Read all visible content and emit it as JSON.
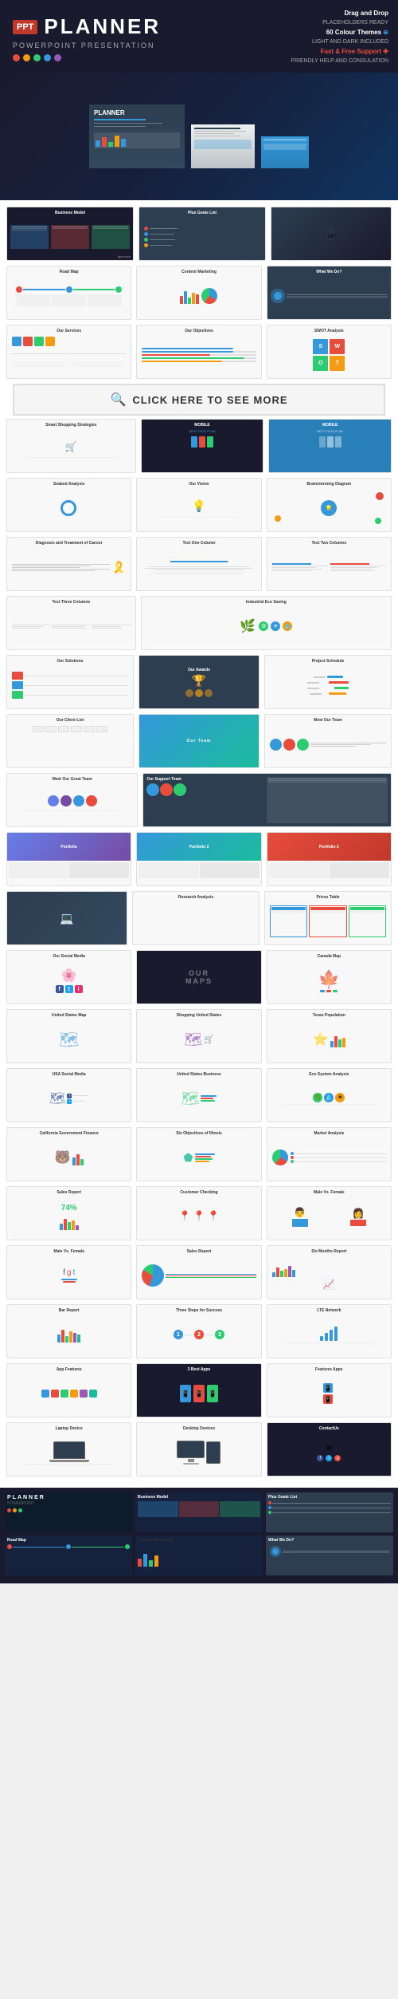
{
  "header": {
    "ppt_label": "PPT",
    "title": "PLANNER",
    "subtitle": "POWERPOINT PRESENTATION",
    "dots": [
      "#e74c3c",
      "#f39c12",
      "#2ecc71",
      "#3498db",
      "#9b59b6"
    ]
  },
  "hero": {
    "features": [
      "Drag and Drop",
      "PLACEHOLDERS READY",
      "60 Colour Themes",
      "LIGHT AND DARK INCLUDED",
      "Fast & Free Support",
      "FRIENDLY HELP AND CONSULATION"
    ]
  },
  "cta": {
    "text": "CLICK HERE TO SEE MORE",
    "icon": "🔍"
  },
  "slides": {
    "row1": [
      {
        "title": "Business Model",
        "type": "dark_logo"
      },
      {
        "title": "Plus Goals List",
        "type": "list_dark"
      },
      {
        "title": "",
        "type": "photo_dark"
      }
    ],
    "row2": [
      {
        "title": "Road Map",
        "type": "roadmap"
      },
      {
        "title": "Content Marketing",
        "type": "charts"
      },
      {
        "title": "What We Do?",
        "type": "what_we_do"
      }
    ],
    "row3": [
      {
        "title": "Our Services",
        "type": "services"
      },
      {
        "title": "Our Objectives",
        "type": "objectives"
      },
      {
        "title": "SWOT Analysis",
        "type": "swot"
      }
    ],
    "row4": [
      {
        "title": "Smart Shopping Strategies",
        "type": "shopping"
      },
      {
        "title": "Mobile Best Data Plan",
        "type": "mobile_dark"
      },
      {
        "title": "Mobile Best Data Plan",
        "type": "mobile_blue"
      }
    ],
    "row5": [
      {
        "title": "Seabed Analysis",
        "type": "analysis"
      },
      {
        "title": "Our Vision",
        "type": "vision"
      },
      {
        "title": "Brainstorming Diagram",
        "type": "brainstorm"
      }
    ],
    "row6": [
      {
        "title": "Diagnosis and Treatment of Cancer",
        "type": "cancer"
      },
      {
        "title": "Text One Column",
        "type": "text1col"
      },
      {
        "title": "Test Two Columns",
        "type": "text2col"
      }
    ],
    "row7": [
      {
        "title": "Test Three Columns",
        "type": "text3col"
      },
      {
        "title": "Industrial Eco Saving",
        "type": "eco"
      }
    ],
    "row8": [
      {
        "title": "Our Solutions",
        "type": "solutions"
      },
      {
        "title": "Our Awards",
        "type": "awards"
      },
      {
        "title": "Project Schedule",
        "type": "schedule"
      }
    ],
    "row9": [
      {
        "title": "Our Client List",
        "type": "clients"
      },
      {
        "title": "",
        "type": "photo_team"
      },
      {
        "title": "Meet Our Team",
        "type": "meet_team"
      }
    ],
    "row10": [
      {
        "title": "Meet Our Great Team",
        "type": "great_team"
      },
      {
        "title": "Our Support Team",
        "type": "support_team"
      }
    ],
    "row11": [
      {
        "title": "Portfolio",
        "type": "portfolio1"
      },
      {
        "title": "Portfolio 2",
        "type": "portfolio2"
      },
      {
        "title": "Portfolio 3",
        "type": "portfolio3"
      }
    ],
    "row12": [
      {
        "title": "",
        "type": "photo_laptop"
      },
      {
        "title": "Research Analysis",
        "type": "research"
      },
      {
        "title": "Prices Table",
        "type": "prices"
      }
    ],
    "row13": [
      {
        "title": "Our Social Media",
        "type": "social_media"
      },
      {
        "title": "OUR MAPS",
        "type": "our_maps"
      },
      {
        "title": "Canada Map",
        "type": "canada_map"
      }
    ],
    "row14": [
      {
        "title": "United States Map",
        "type": "us_map"
      },
      {
        "title": "Shopping United States",
        "type": "shopping_us"
      },
      {
        "title": "Texas Population",
        "type": "texas"
      }
    ],
    "row15": [
      {
        "title": "USA Social Media",
        "type": "usa_social"
      },
      {
        "title": "United States Business",
        "type": "us_business"
      },
      {
        "title": "Eco System Analysis",
        "type": "eco_system"
      }
    ],
    "row16": [
      {
        "title": "California Government Finance",
        "type": "california"
      },
      {
        "title": "Six Objectives of Illinois",
        "type": "illinois"
      },
      {
        "title": "Market Analysis",
        "type": "market_analysis"
      }
    ],
    "row17": [
      {
        "title": "Sales Report",
        "type": "sales_report"
      },
      {
        "title": "Customer Checking",
        "type": "customer_checking"
      },
      {
        "title": "Male Vs. Female",
        "type": "male_female"
      }
    ],
    "row18": [
      {
        "title": "Male Vs. Female",
        "type": "male_female2"
      },
      {
        "title": "Sales Report",
        "type": "sales_report2"
      },
      {
        "title": "Six Months Report",
        "type": "six_months"
      }
    ],
    "row19": [
      {
        "title": "Bar Report",
        "type": "bar_report"
      },
      {
        "title": "Three Steps for Success",
        "type": "three_steps"
      },
      {
        "title": "LTE Network",
        "type": "lte_network"
      }
    ],
    "row20": [
      {
        "title": "App Features",
        "type": "app_features"
      },
      {
        "title": "3 Best Apps",
        "type": "best_apps"
      },
      {
        "title": "Features Apps",
        "type": "features_apps"
      }
    ],
    "row21": [
      {
        "title": "Laptop Device",
        "type": "laptop_device"
      },
      {
        "title": "Desktop Devices",
        "type": "desktop_devices"
      },
      {
        "title": "ContactUs",
        "type": "contact_us"
      }
    ]
  },
  "bottom": {
    "slides": [
      {
        "title": "PLANNER",
        "type": "bottom_logo"
      },
      {
        "title": "Business Model",
        "type": "bottom_business"
      },
      {
        "title": "Plus Goals List",
        "type": "bottom_goals"
      }
    ],
    "slides2": [
      {
        "title": "Road Map",
        "type": "bottom_roadmap"
      },
      {
        "title": "Content Marketing",
        "type": "bottom_content"
      },
      {
        "title": "What We Do?",
        "type": "bottom_what"
      }
    ]
  },
  "watermark": {
    "text": "gfxtr.com"
  }
}
